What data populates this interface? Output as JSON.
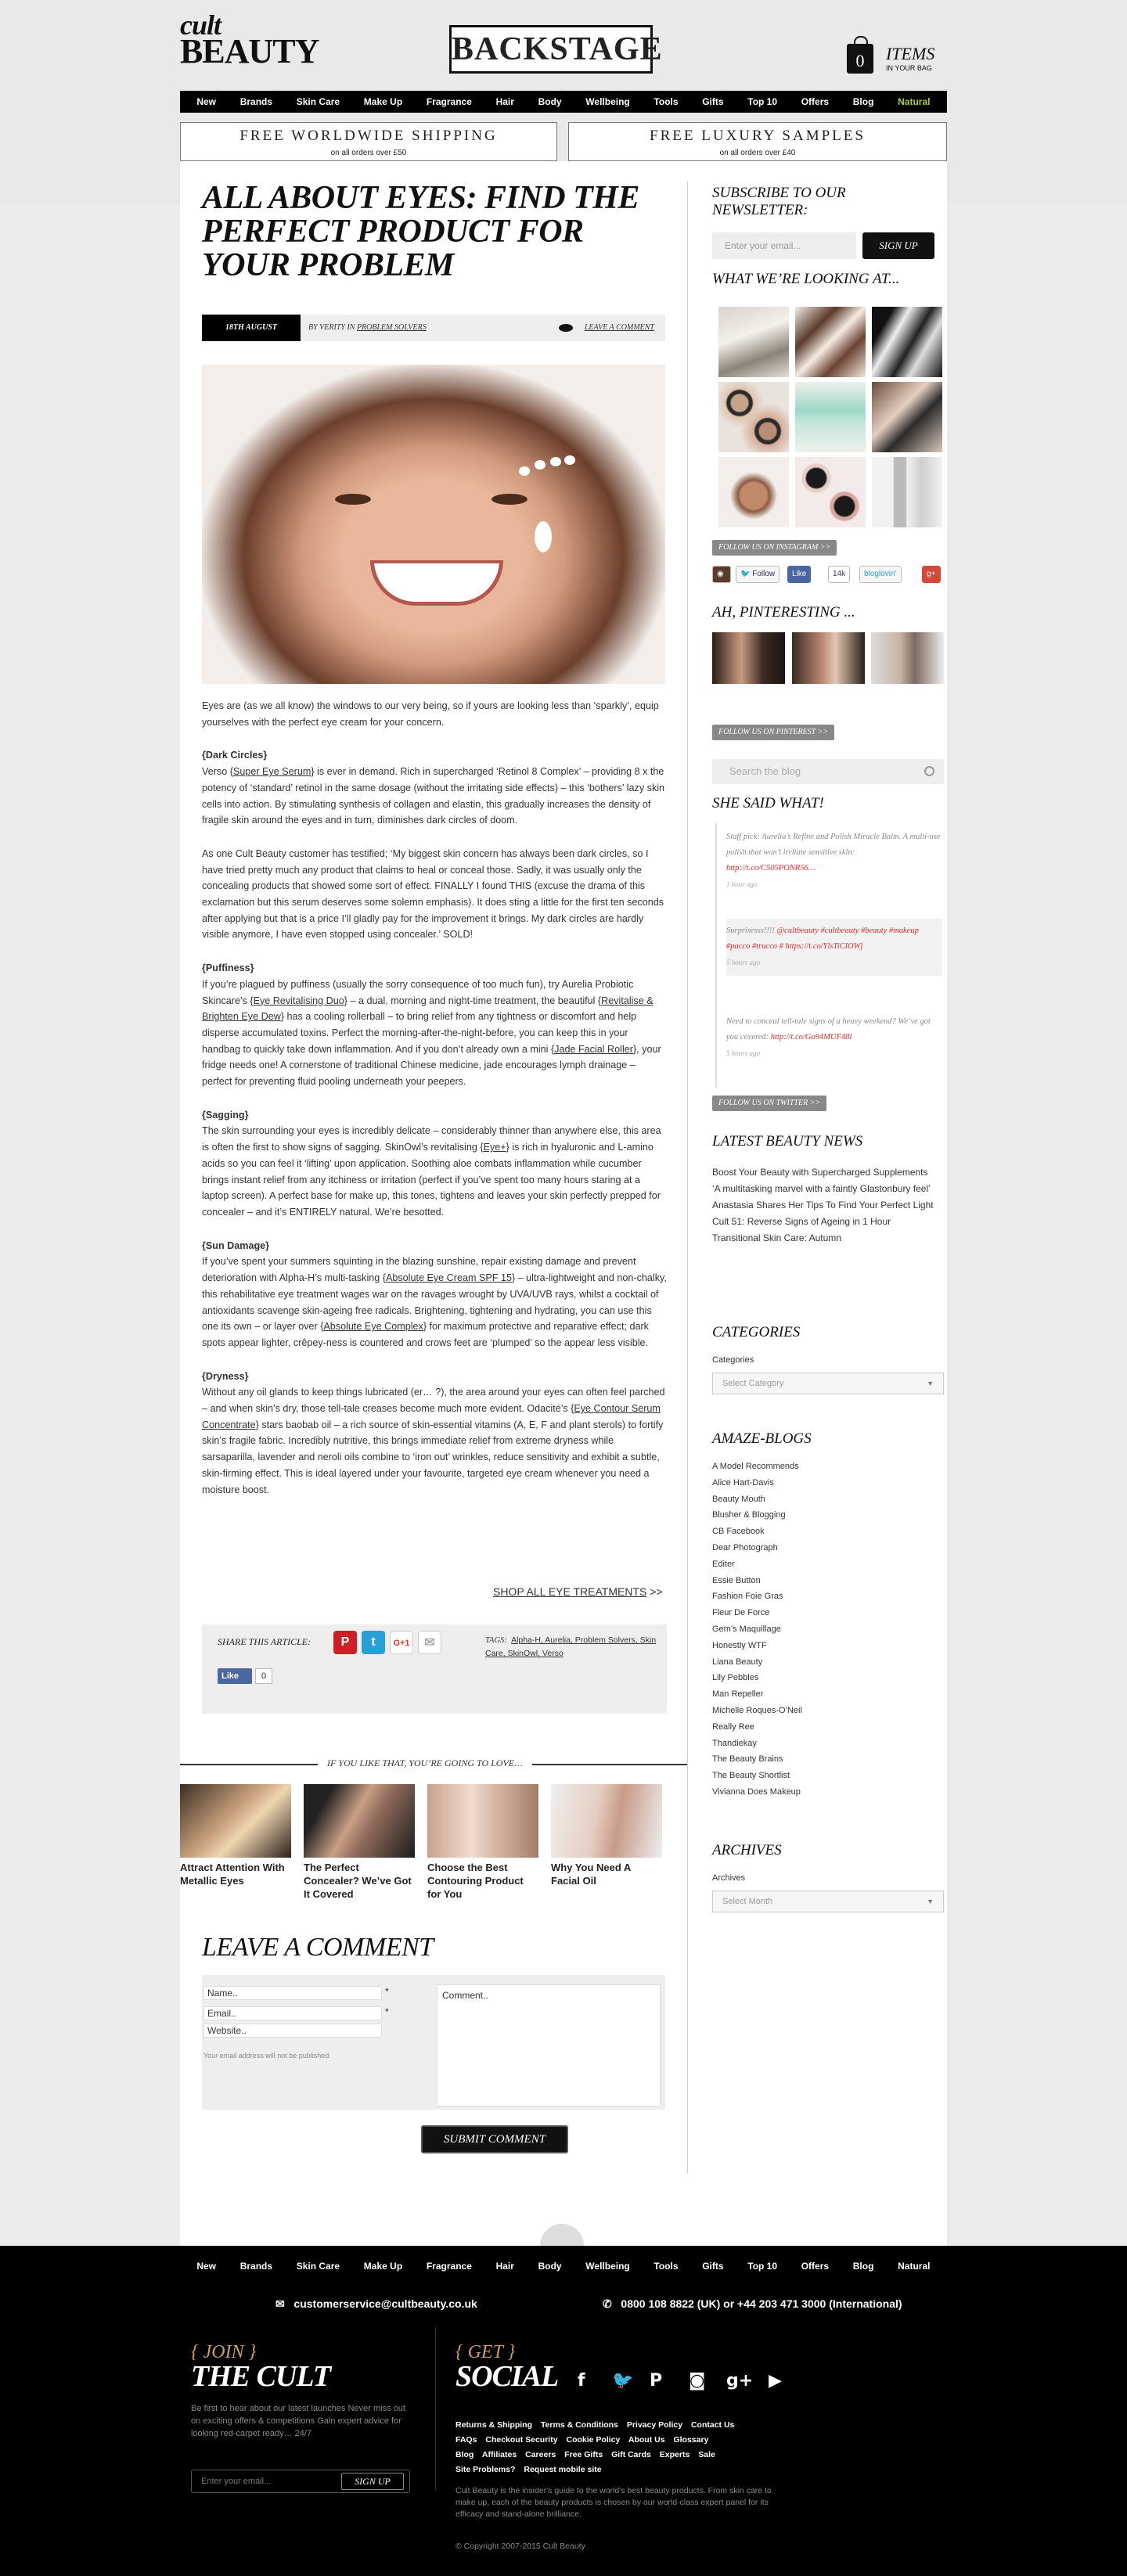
{
  "header": {
    "logo_line1": "cult",
    "logo_line2": "BEAUTY",
    "center_logo": "BACKSTAGE",
    "bag_count": "0",
    "bag_label": "ITEMS",
    "bag_sub": "IN YOUR BAG"
  },
  "nav": [
    "New",
    "Brands",
    "Skin Care",
    "Make Up",
    "Fragrance",
    "Hair",
    "Body",
    "Wellbeing",
    "Tools",
    "Gifts",
    "Top 10",
    "Offers",
    "Blog",
    "Natural"
  ],
  "banners": [
    {
      "title": "FREE WORLDWIDE SHIPPING",
      "sub": "on all orders over £50"
    },
    {
      "title": "FREE LUXURY SAMPLES",
      "sub": "on all orders over £40"
    }
  ],
  "article": {
    "title": "ALL ABOUT EYES: FIND THE PERFECT PRODUCT FOR YOUR PROBLEM",
    "date": "18TH AUGUST",
    "byline": "BY VERITY IN ",
    "category": "PROBLEM SOLVERS",
    "leave_comment": "LEAVE A COMMENT",
    "intro": "Eyes are (as we all know) the windows to our very being, so if yours are looking less than ‘sparkly’, equip yourselves with the perfect eye cream for your concern.",
    "s1_head": "{Dark Circles}",
    "s1_a": "Verso {",
    "s1_link": "Super Eye Serum",
    "s1_b": "} is ever in demand. Rich in supercharged ‘Retinol 8 Complex’ – providing 8 x the potency of ‘standard’ retinol in the same dosage (without the irritating side effects) – this ‘bothers’ lazy skin cells into action. By stimulating synthesis of collagen and elastin, this gradually increases the density of fragile skin around the eyes and in turn, diminishes dark circles of doom.",
    "quote": "As one Cult Beauty customer has testified; ‘My biggest skin concern has always been dark circles, so I have tried pretty much any product that claims to heal or conceal those. Sadly, it was usually only the concealing products that showed some sort of effect. FINALLY I found THIS (excuse the drama of this exclamation but this serum deserves some solemn emphasis). It does sting a little for the first ten seconds after applying but that is a price I’ll gladly pay for the improvement it brings. My dark circles are hardly visible anymore, I have even stopped using concealer.’ SOLD!",
    "s2_head": "{Puffiness}",
    "s2_a": "If you’re plagued by puffiness (usually the sorry consequence of too much fun), try Aurelia Probiotic Skincare’s {",
    "s2_link1": "Eye Revitalising Duo",
    "s2_b": "} – a dual, morning and night-time treatment, the beautiful {",
    "s2_link2": "Revitalise & Brighten Eye Dew",
    "s2_c": "} has a cooling rollerball – to bring relief from any tightness or discomfort and help disperse accumulated toxins. Perfect the morning-after-the-night-before, you can keep this in your handbag to quickly take down inflammation. And if you don’t already own a mini {",
    "s2_link3": "Jade Facial Roller",
    "s2_d": "}, your fridge needs one! A cornerstone of traditional Chinese medicine, jade encourages lymph drainage – perfect for preventing fluid pooling underneath your peepers.",
    "s3_head": "{Sagging}",
    "s3_a": "The skin surrounding your eyes is incredibly delicate – considerably thinner than anywhere else, this area is often the first to show signs of sagging. SkinOwl’s revitalising {",
    "s3_link": "Eye+",
    "s3_b": "} is rich in hyaluronic and L-amino acids so you can feel it ‘lifting’ upon application. Soothing aloe combats inflammation while cucumber brings instant relief from any itchiness or irritation (perfect if you’ve spent too many hours staring at a laptop screen). A perfect base for make up, this tones, tightens and leaves your skin perfectly prepped for concealer – and it’s ENTIRELY natural. We’re besotted.",
    "s4_head": "{Sun Damage}",
    "s4_a": "If you’ve spent your summers squinting in the blazing sunshine, repair existing damage and prevent deterioration with Alpha-H’s multi-tasking {",
    "s4_link1": "Absolute Eye Cream SPF 15",
    "s4_b": "} – ultra-lightweight and non-chalky, this rehabilitative eye treatment wages war on the ravages wrought by UVA/UVB rays, whilst a cocktail of antioxidants scavenge skin-ageing free radicals. Brightening, tightening and hydrating, you can use this one its own – or layer over {",
    "s4_link2": "Absolute Eye Complex",
    "s4_c": "} for maximum protective and reparative effect; dark spots appear lighter, crêpey-ness is countered and crows feet are ‘plumped’ so the appear less visible.",
    "s5_head": "{Dryness}",
    "s5_a": "Without any oil glands to keep things lubricated (er… ?), the area around your eyes can often feel parched – and when skin’s dry, those tell-tale creases become much more evident. Odacité’s {",
    "s5_link": "Eye Contour Serum Concentrate",
    "s5_b": "} stars baobab oil – a rich source of skin-essential vitamins (A, E, F and plant sterols) to fortify skin’s fragile fabric. Incredibly nutritive, this brings immediate relief from extreme dryness while sarsaparilla, lavender and neroli oils combine to ‘iron out’ wrinkles, reduce sensitivity and exhibit a subtle, skin-firming effect. This is ideal layered under your favourite, targeted eye cream whenever you need a moisture boost.",
    "shop_all": "SHOP ALL EYE TREATMENTS",
    "shop_arrow": " >>"
  },
  "share": {
    "label": "SHARE THIS ARTICLE:",
    "tags_label": "TAGS:",
    "tags": "Alpha-H, Aurelia, Problem Solvers, Skin Care, SkinOwl, Verso",
    "like": "Like",
    "like_count": "0"
  },
  "related": {
    "heading": "IF YOU LIKE THAT, YOU’RE GOING TO LOVE…",
    "items": [
      {
        "title": "Attract Attention With Metallic Eyes"
      },
      {
        "title": "The Perfect Concealer? We’ve Got It Covered"
      },
      {
        "title": "Choose the Best Contouring Product for You"
      },
      {
        "title": "Why You Need A Facial Oil"
      }
    ]
  },
  "comment_form": {
    "heading": "LEAVE A COMMENT",
    "name_ph": "Name..",
    "email_ph": "Email..",
    "website_ph": "Website..",
    "comment_ph": "Comment..",
    "required": "*",
    "note": "Your email address will not be published.",
    "submit": "SUBMIT COMMENT"
  },
  "sidebar": {
    "newsletter_h": "SUBSCRIBE TO OUR NEWSLETTER:",
    "email_ph": "Enter your email...",
    "signup": "SIGN UP",
    "looking_h": "WHAT WE’RE LOOKING AT...",
    "follow_ig": "FOLLOW US ON INSTAGRAM >>",
    "follow_btn": "Follow",
    "like_btn": "Like",
    "like_count": "14k",
    "bloglovin": "bloglovin’",
    "pin_h": "AH, PINTERESTING ...",
    "follow_pin": "FOLLOW US ON PINTEREST >>",
    "search_ph": "Search the blog",
    "she_said_h": "SHE SAID WHAT!",
    "tweets": [
      {
        "text": "Staff pick: Aurelia’s Refine and Polish Miracle Balm. A multi-use polish that won’t irritate sensitive skin: ",
        "link": "http://t.co/C505PONR56…",
        "ago": "1 hour ago"
      },
      {
        "text": "Surprisesss!!!! ",
        "link": "@cultbeauty #cultbeauty #beauty #makeup #pacco #trucco # https://t.co/YlsTiCIOWj",
        "ago": "5 hours ago"
      },
      {
        "text": "Need to conceal tell-tale signs of a heavy weekend? We’ve got you covered: ",
        "link": "http://t.co/Go94MUF48l",
        "ago": "5 hours ago"
      }
    ],
    "follow_tw": "FOLLOW US ON TWITTER >>",
    "news_h": "LATEST BEAUTY NEWS",
    "news": [
      "Boost Your Beauty with Supercharged Supplements",
      "‘A multitasking marvel with a faintly Glastonbury feel’",
      "Anastasia Shares Her Tips To Find Your Perfect Light",
      "Cult 51: Reverse Signs of Ageing in 1 Hour",
      "Transitional Skin Care: Autumn"
    ],
    "categories_h": "CATEGORIES",
    "categories_lbl": "Categories",
    "categories_sel": "Select Category",
    "blogs_h": "AMAZE-BLOGS",
    "blogs": [
      "A Model Recommends",
      "Alice Hart-Davis",
      "Beauty Mouth",
      "Blusher & Blogging",
      "CB Facebook",
      "Dear Photograph",
      "Editer",
      "Essie Button",
      "Fashion Foie Gras",
      "Fleur De Force",
      "Gem’s Maquillage",
      "Honestly WTF",
      "Liana Beauty",
      "Lily Pebbles",
      "Man Repeller",
      "Michelle Roques-O’Neil",
      "Really Ree",
      "Thandiekay",
      "The Beauty Brains",
      "The Beauty Shortlist",
      "Vivianna Does Makeup"
    ],
    "archives_h": "ARCHIVES",
    "archives_lbl": "Archives",
    "archives_sel": "Select Month"
  },
  "footer": {
    "email": "customerservice@cultbeauty.co.uk",
    "phone": "0800 108 8822 (UK) or +44 203 471 3000 (International)",
    "join_k": "{ JOIN }",
    "join_big": "THE CULT",
    "join_text": "Be first to hear about our latest launches Never miss out on exciting offers & competitions Gain expert advice for looking red-carpet ready… 24/7",
    "email_ph": "Enter your email...",
    "signup": "SIGN UP",
    "get_k": "{ GET }",
    "get_big": "SOCIAL",
    "links": [
      "Returns & Shipping",
      "Terms & Conditions",
      "Privacy Policy",
      "Contact Us",
      "FAQs",
      "Checkout Security",
      "Cookie Policy",
      "About Us",
      "Glossary",
      "Blog",
      "Affiliates",
      "Careers",
      "Free Gifts",
      "Gift Cards",
      "Experts",
      "Sale",
      "Site Problems?",
      "Request mobile site"
    ],
    "desc": "Cult Beauty is the insider's guide to the world's best beauty products. From skin care to make up, each of the beauty products is chosen by our world-class expert panel for its efficacy and stand-alone brilliance.",
    "copyright": "© Copyright 2007-2015 Cult Beauty"
  },
  "colors": {
    "accent_red": "#e0282f",
    "natural_green": "#a4cf3a",
    "footer_gold": "#c9a063",
    "black": "#000000"
  }
}
